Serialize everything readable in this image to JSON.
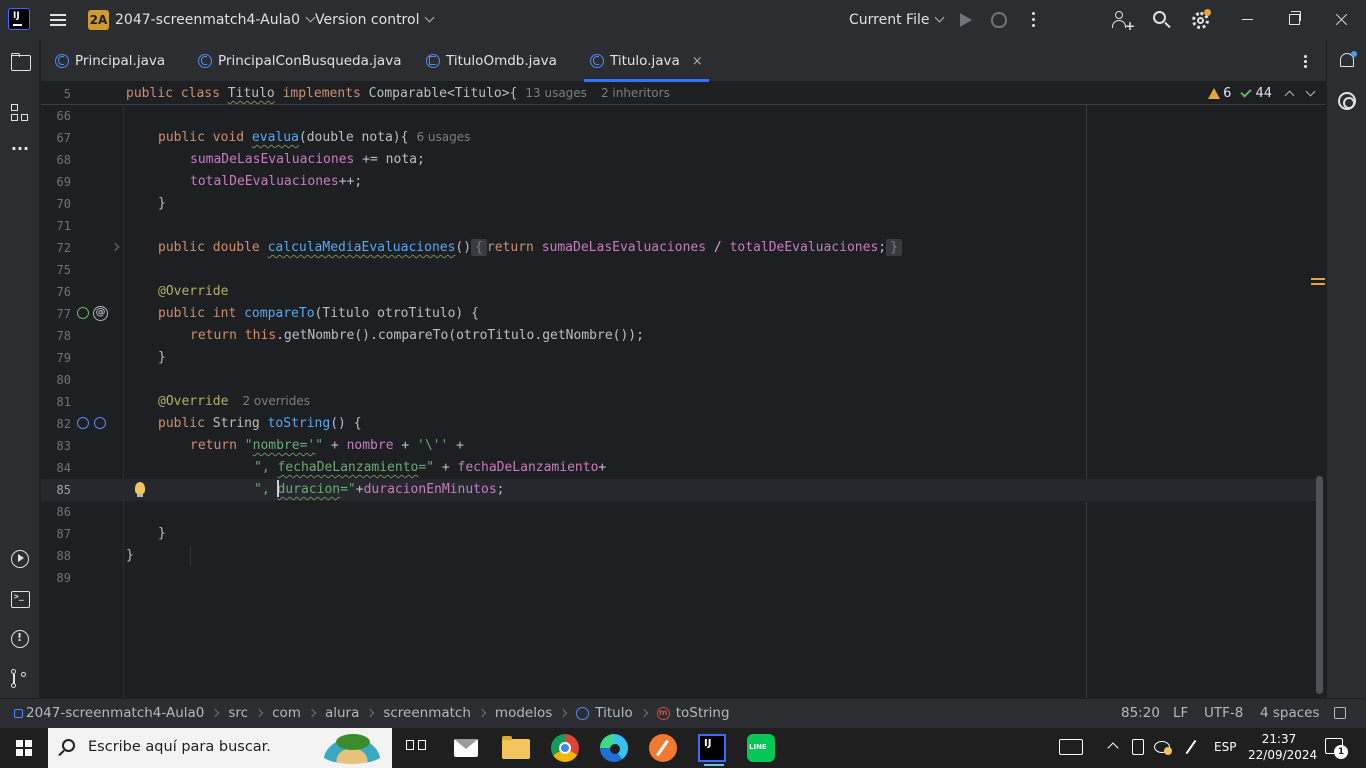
{
  "titlebar": {
    "project_badge": "2A",
    "project_name": "2047-screenmatch4-Aula0",
    "version_control": "Version control",
    "run_config": "Current File"
  },
  "tabs": [
    {
      "label": "Principal.java",
      "active": false
    },
    {
      "label": "PrincipalConBusqueda.java",
      "active": false
    },
    {
      "label": "TituloOmdb.java",
      "active": false
    },
    {
      "label": "Titulo.java",
      "active": true,
      "close": "×"
    }
  ],
  "inspections": {
    "warnings": "6",
    "weak_warnings": "44"
  },
  "sticky_line": {
    "number": "5",
    "public": "public",
    "class": "class",
    "name": "Titulo",
    "implements": "implements",
    "rest": "Comparable<Titulo>{",
    "usages_hint": "13 usages",
    "inheritors_hint": "2 inheritors"
  },
  "code": {
    "l66": {
      "n": "66"
    },
    "l67": {
      "n": "67",
      "t1": "public void ",
      "t2": "evalua",
      "t3": "(double nota){",
      "hint": "6 usages"
    },
    "l68": {
      "n": "68",
      "t1": "sumaDeLasEvaluaciones",
      "t2": " += nota;"
    },
    "l69": {
      "n": "69",
      "t1": "totalDeEvaluaciones",
      "t2": "++;"
    },
    "l70": {
      "n": "70",
      "t1": "}"
    },
    "l71": {
      "n": "71"
    },
    "l72": {
      "n": "72",
      "t1": "public double ",
      "t2": "calculaMediaEvaluaciones",
      "t3": "()",
      "t4": "{",
      "t5": "return ",
      "t6": "sumaDeLasEvaluaciones",
      "t7": " / ",
      "t8": "totalDeEvaluaciones",
      "t9": ";",
      "t10": "}"
    },
    "l75": {
      "n": "75"
    },
    "l76": {
      "n": "76",
      "t1": "@Override"
    },
    "l77": {
      "n": "77",
      "t1": "public int ",
      "t2": "compareTo",
      "t3": "(Titulo otroTitulo) {"
    },
    "l78": {
      "n": "78",
      "t1": "return this",
      "t2": ".getNombre().compareTo(otroTitulo.getNombre());"
    },
    "l79": {
      "n": "79",
      "t1": "}"
    },
    "l80": {
      "n": "80"
    },
    "l81": {
      "n": "81",
      "t1": "@Override",
      "hint": "2 overrides"
    },
    "l82": {
      "n": "82",
      "t1": "public ",
      "t2": "String ",
      "t3": "toString",
      "t4": "() {"
    },
    "l83": {
      "n": "83",
      "t1": "return ",
      "t2": "\"",
      "t3": "nombre='",
      "t4": "\"",
      "t5": " + ",
      "t6": "nombre",
      "t7": " + ",
      "t8": "'\\''",
      "t9": " +"
    },
    "l84": {
      "n": "84",
      "t1": "\", ",
      "t2": "fechaDeLanzamiento",
      "t3": "=\"",
      "t4": " + ",
      "t5": "fechaDeLanzamiento",
      "t6": "+"
    },
    "l85": {
      "n": "85",
      "t1": "\", ",
      "t2": "duracion",
      "t3": "=\"",
      "t4": "+",
      "t5": "duracionEnMinutos",
      "t6": ";"
    },
    "l86": {
      "n": "86"
    },
    "l87": {
      "n": "87",
      "t1": "}"
    },
    "l88": {
      "n": "88",
      "t1": "}"
    },
    "l89": {
      "n": "89"
    }
  },
  "breadcrumbs": [
    "2047-screenmatch4-Aula0",
    "src",
    "com",
    "alura",
    "screenmatch",
    "modelos",
    "Titulo",
    "toString"
  ],
  "status": {
    "position": "85:20",
    "line_sep": "LF",
    "encoding": "UTF-8",
    "indent": "4 spaces"
  },
  "taskbar": {
    "search_placeholder": "Escribe aquí para buscar.",
    "lang": "ESP",
    "time": "21:37",
    "date": "22/09/2024",
    "notifications": "1"
  },
  "colors": {
    "accent": "#3574f0",
    "keyword": "#cf8e6d",
    "function": "#56a8f5",
    "field": "#c77dbb",
    "string": "#6aab73",
    "annotation": "#b3ae60"
  }
}
